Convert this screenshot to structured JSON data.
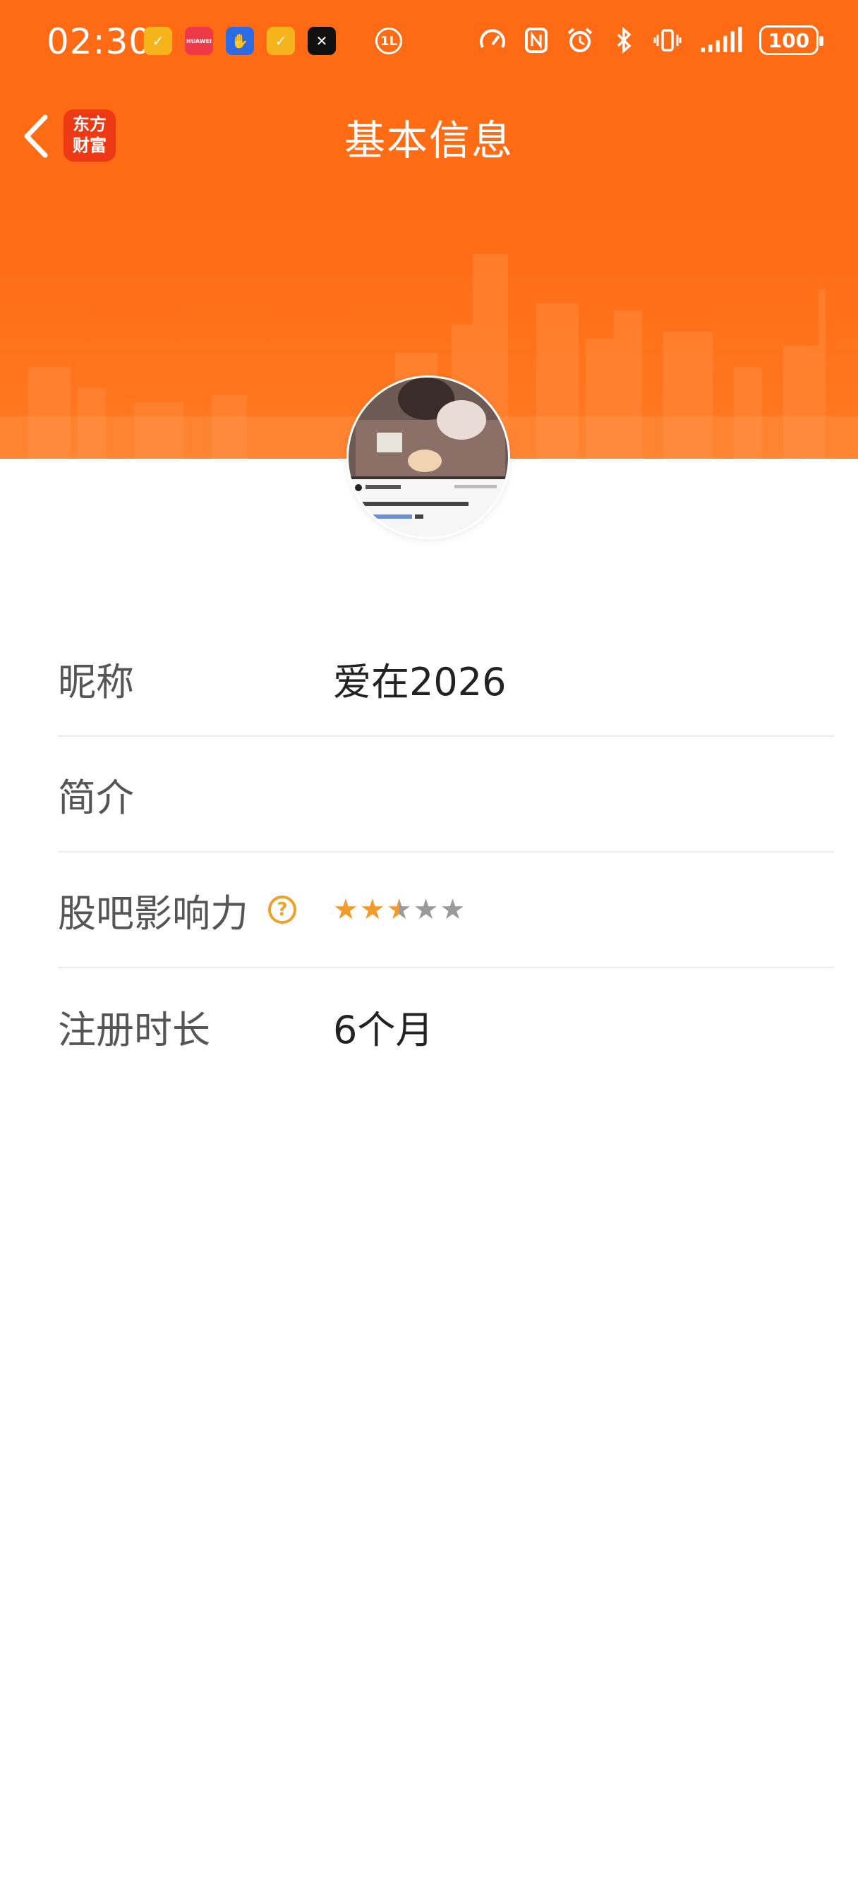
{
  "status_bar": {
    "time": "02:30",
    "notification_icons": [
      "app-yellow-icon",
      "huawei-store-icon",
      "hand-app-icon",
      "app-yellow-icon",
      "capcut-icon",
      "data-saver-icon"
    ],
    "huawei_label": "HUAWEI",
    "data_saver_label": "1L",
    "battery": "100"
  },
  "nav": {
    "title": "基本信息",
    "logo_line1": "东方",
    "logo_line2": "财富"
  },
  "avatar": {
    "caption_name": "爱我的猫猫",
    "caption_text": "和美团打架的结果就是瘦胖了",
    "caption_tag": "#猫咪 #搞笑"
  },
  "profile": {
    "nickname_label": "昵称",
    "nickname_value": "爱在2026",
    "bio_label": "简介",
    "bio_value": "",
    "influence_label": "股吧影响力",
    "influence_help": "?",
    "influence_stars": 2.5,
    "influence_max": 5,
    "register_label": "注册时长",
    "register_value": "6个月"
  },
  "colors": {
    "banner": "#ff6a14",
    "star_active": "#f29a2a",
    "star_inactive": "#9a9a9a"
  }
}
